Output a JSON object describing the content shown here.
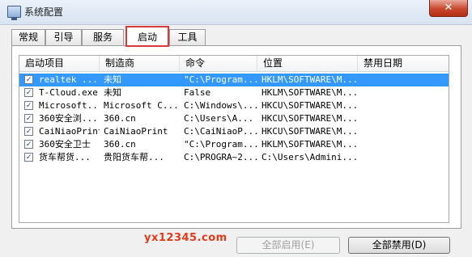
{
  "window": {
    "title": "系统配置",
    "close_label": "✕"
  },
  "tabs": [
    {
      "label": "常规"
    },
    {
      "label": "引导"
    },
    {
      "label": "服务"
    },
    {
      "label": "启动",
      "active": true
    },
    {
      "label": "工具"
    }
  ],
  "table": {
    "columns": [
      "启动项目",
      "制造商",
      "命令",
      "位置",
      "禁用日期"
    ],
    "rows": [
      {
        "checked": true,
        "selected": true,
        "name": "realtek ...",
        "maker": "未知",
        "command": "\"C:\\Program...",
        "location": "HKLM\\SOFTWARE\\M...",
        "date": ""
      },
      {
        "checked": true,
        "name": "T-Cloud.exe",
        "maker": "未知",
        "command": "False",
        "location": "HKLM\\SOFTWARE\\M...",
        "date": ""
      },
      {
        "checked": true,
        "name": "Microsoft...",
        "maker": "Microsoft C...",
        "command": "C:\\Windows\\...",
        "location": "HKCU\\SOFTWARE\\M...",
        "date": ""
      },
      {
        "checked": true,
        "name": "360安全浏...",
        "maker": "360.cn",
        "command": "C:\\Users\\A...",
        "location": "HKCU\\SOFTWARE\\M...",
        "date": ""
      },
      {
        "checked": true,
        "name": "CaiNiaoPrint",
        "maker": "CaiNiaoPrint",
        "command": "C:\\CaiNiaoP...",
        "location": "HKCU\\SOFTWARE\\M...",
        "date": ""
      },
      {
        "checked": true,
        "name": "360安全卫士",
        "maker": "360.cn",
        "command": "\"C:\\Program...",
        "location": "HKLM\\SOFTWARE\\M...",
        "date": ""
      },
      {
        "checked": true,
        "name": "货车帮货...",
        "maker": "贵阳货车帮...",
        "command": "C:\\PROGRA~2...",
        "location": "C:\\Users\\Admini...",
        "date": ""
      }
    ]
  },
  "watermark": "yx12345.com",
  "buttons": {
    "enable_all": "全部启用(E)",
    "disable_all": "全部禁用(D)"
  },
  "checkbox_glyph": "✓"
}
